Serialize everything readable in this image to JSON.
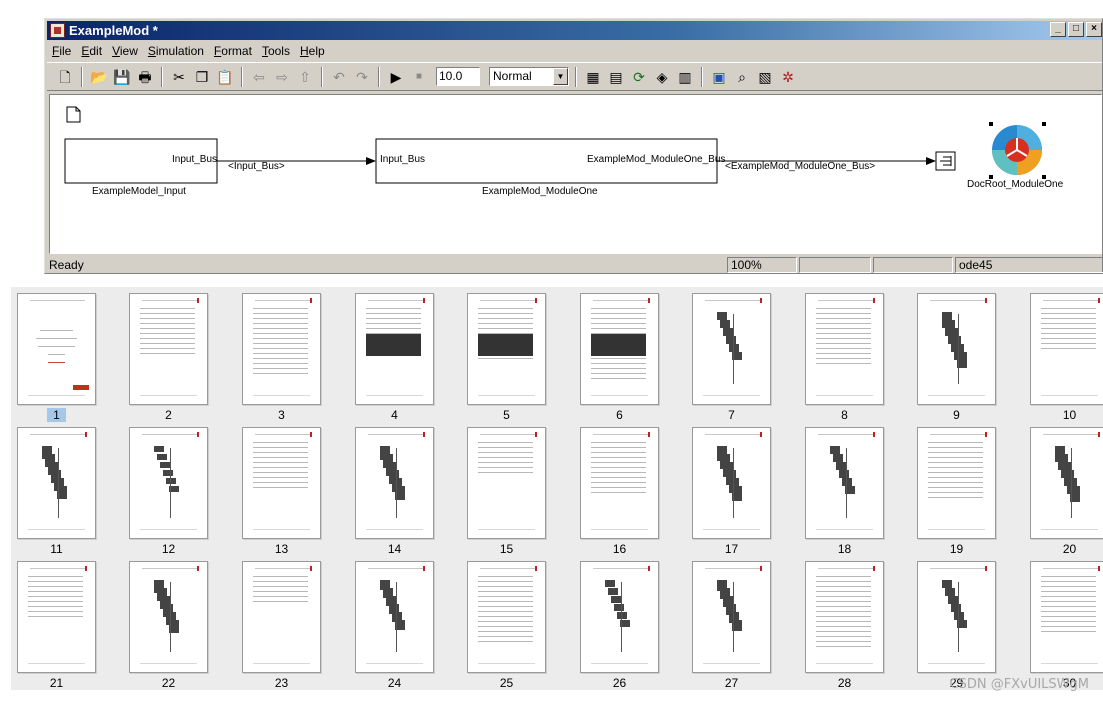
{
  "window": {
    "title": "ExampleMod *",
    "controls": [
      "_",
      "□",
      "×"
    ]
  },
  "menu": [
    "File",
    "Edit",
    "View",
    "Simulation",
    "Format",
    "Tools",
    "Help"
  ],
  "toolbar": {
    "icons": [
      {
        "name": "new-icon",
        "glyph": "🗋"
      },
      {
        "name": "open-icon",
        "glyph": "📂"
      },
      {
        "name": "save-icon",
        "glyph": "💾"
      },
      {
        "name": "print-icon",
        "glyph": "🖶"
      },
      {
        "name": "cut-icon",
        "glyph": "✂"
      },
      {
        "name": "copy-icon",
        "glyph": "❐"
      },
      {
        "name": "paste-icon",
        "glyph": "📋"
      },
      {
        "name": "back-icon",
        "glyph": "⇦"
      },
      {
        "name": "forward-icon",
        "glyph": "⇨"
      },
      {
        "name": "up-icon",
        "glyph": "⇧"
      },
      {
        "name": "undo-icon",
        "glyph": "↶"
      },
      {
        "name": "redo-icon",
        "glyph": "↷"
      },
      {
        "name": "run-icon",
        "glyph": "▶"
      },
      {
        "name": "stop-icon",
        "glyph": "■"
      }
    ],
    "stop_time": "10.0",
    "sim_mode": "Normal",
    "right_icons": [
      {
        "name": "build-icon",
        "glyph": "▦"
      },
      {
        "name": "update-diagram-icon",
        "glyph": "▤"
      },
      {
        "name": "refresh-icon",
        "glyph": "⟳"
      },
      {
        "name": "library-browser-icon",
        "glyph": "◈"
      },
      {
        "name": "model-explorer-icon",
        "glyph": "▥"
      },
      {
        "name": "debugger-icon",
        "glyph": "▣"
      },
      {
        "name": "search-icon",
        "glyph": "⌕"
      },
      {
        "name": "property-icon",
        "glyph": "▧"
      },
      {
        "name": "settings-icon",
        "glyph": "✲"
      }
    ]
  },
  "diagram": {
    "block_input": {
      "port_label": "Input_Bus",
      "name": "ExampleModel_Input"
    },
    "signal_1": "<Input_Bus>",
    "block_module": {
      "in_port": "Input_Bus",
      "out_port": "ExampleMod_ModuleOne_Bus",
      "name": "ExampleMod_ModuleOne"
    },
    "signal_2": "<ExampleMod_ModuleOne_Bus>",
    "docroot_name": "DocRoot_ModuleOne"
  },
  "status": {
    "left": "Ready",
    "zoom": "100%",
    "solver": "ode45"
  },
  "pages": [
    "1",
    "2",
    "3",
    "4",
    "5",
    "6",
    "7",
    "8",
    "9",
    "10",
    "11",
    "12",
    "13",
    "14",
    "15",
    "16",
    "17",
    "18",
    "19",
    "20",
    "21",
    "22",
    "23",
    "24",
    "25",
    "26",
    "27",
    "28",
    "29",
    "30"
  ],
  "selected_page": "1",
  "watermark": "CSDN @FXvUILSWgM"
}
